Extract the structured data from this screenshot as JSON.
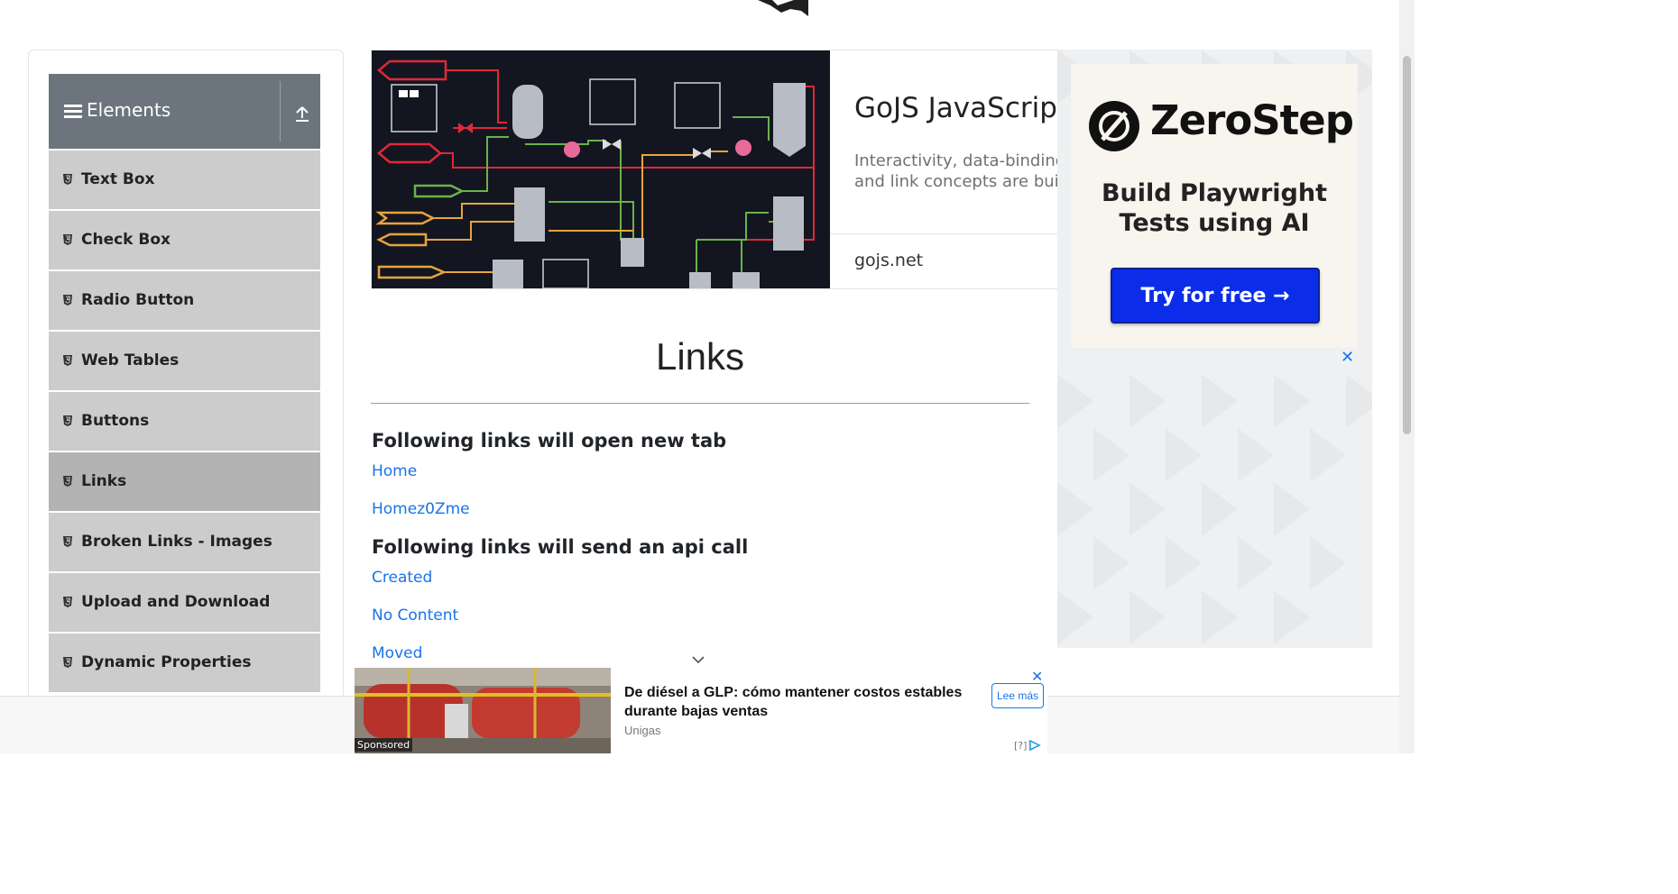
{
  "sidebar": {
    "group_title": "Elements",
    "items": [
      {
        "label": "Text Box"
      },
      {
        "label": "Check Box"
      },
      {
        "label": "Radio Button"
      },
      {
        "label": "Web Tables"
      },
      {
        "label": "Buttons"
      },
      {
        "label": "Links",
        "active": true
      },
      {
        "label": "Broken Links - Images"
      },
      {
        "label": "Upload and Download"
      },
      {
        "label": "Dynamic Properties"
      }
    ]
  },
  "banner_ad": {
    "title": "GoJS JavaScript",
    "description": "Interactivity, data-binding, and link concepts are built",
    "url": "gojs.net"
  },
  "main": {
    "title": "Links",
    "section1_heading": "Following links will open new tab",
    "section1_links": [
      "Home",
      "Homez0Zme"
    ],
    "section2_heading": "Following links will send an api call",
    "section2_links": [
      "Created",
      "No Content",
      "Moved"
    ]
  },
  "side_ad": {
    "brand": "ZeroStep",
    "tagline_line1": "Build Playwright",
    "tagline_line2": "Tests using AI",
    "cta": "Try for free →",
    "close": "✕"
  },
  "bottom_ad": {
    "sponsored": "Sponsored",
    "headline": "De diésel a GLP: cómo mantener costos estables durante bajas ventas",
    "advertiser": "Unigas",
    "cta": "Lee más",
    "close": "✕",
    "info": "[?]"
  },
  "colors": {
    "sidebar_header": "#6c757d",
    "sidebar_item": "#cccccc",
    "sidebar_item_active": "#b3b3b3",
    "link": "#1a73e8",
    "zerostep_button": "#0b2dea"
  }
}
